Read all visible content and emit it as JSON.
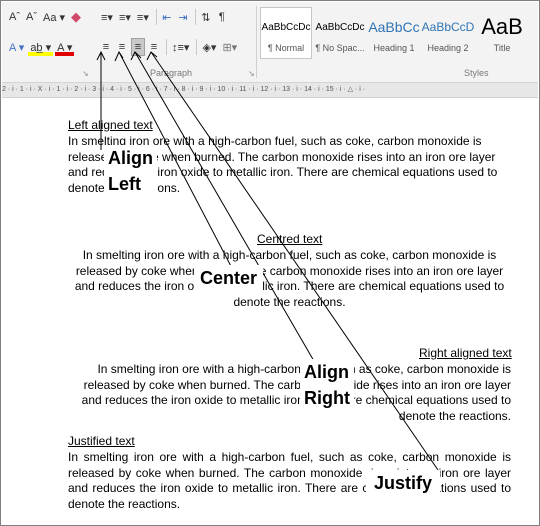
{
  "ribbon": {
    "font_row_top": [
      "Aˆ",
      "Aˇ",
      "Aa ▾"
    ],
    "font_row_bottom": [
      "A ▾",
      "ab̲ ▾",
      "A ▾"
    ],
    "paragraph_group_label": "Paragraph",
    "styles_group_label": "Styles",
    "styles": [
      {
        "preview": "AaBbCcDc",
        "name": "¶ Normal",
        "size": "10px",
        "color": "#000000"
      },
      {
        "preview": "AaBbCcDc",
        "name": "¶ No Spac...",
        "size": "10px",
        "color": "#000000"
      },
      {
        "preview": "AaBbCc",
        "name": "Heading 1",
        "size": "14px",
        "color": "#2e74b5"
      },
      {
        "preview": "AaBbCcD",
        "name": "Heading 2",
        "size": "12px",
        "color": "#2e74b5"
      },
      {
        "preview": "AaB",
        "name": "Title",
        "size": "22px",
        "color": "#000000"
      }
    ]
  },
  "ruler": {
    "text": "2 · i · 1 · i · X · i · 1 · i · 2 · i · 3 · i · 4 · i · 5 · i · 6 · i · 7 · i · 8 · i · 9 · i · 10 · i · 11 · i · 12 · i · 13 · i · 14 · i · 15 · i · △ · i ·"
  },
  "document": {
    "left": {
      "heading": "Left aligned text",
      "body": "In smelting iron ore with a high-carbon fuel, such as coke, carbon monoxide is released by coke when burned. The carbon monoxide rises into an iron ore layer and reduces the iron oxide to metallic iron. There are chemical equations used to denote the reactions."
    },
    "center": {
      "heading": "Centred text",
      "body": "In smelting iron ore with a high-carbon fuel, such as coke, carbon monoxide is released by coke when burned. The carbon monoxide rises into an iron ore layer and reduces the iron oxide to metallic iron. There are chemical equations used to denote the reactions."
    },
    "right": {
      "heading": "Right aligned text",
      "body": "In smelting iron ore with a high-carbon fuel, such as coke, carbon monoxide is released by coke when burned. The carbon monoxide rises into an iron ore layer and reduces the iron oxide to metallic iron. There are chemical equations used to denote the reactions."
    },
    "justify": {
      "heading": "Justified text",
      "body": "In smelting iron ore with a high-carbon fuel, such as coke, carbon monoxide is released by coke when burned. The carbon monoxide rises into an iron ore layer and reduces the iron oxide to metallic iron. There are chemical equations used to denote the reactions."
    }
  },
  "callouts": {
    "align_left": "Align\nLeft",
    "center": "Center",
    "align_right": "Align\nRight",
    "justify": "Justify"
  }
}
